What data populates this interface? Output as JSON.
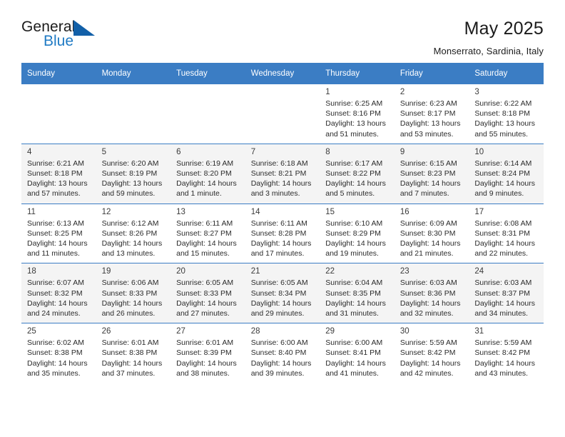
{
  "brand": {
    "name_top": "General",
    "name_bottom": "Blue",
    "triangle_color": "#1260a8",
    "blue_text_color": "#1f7ac4"
  },
  "header": {
    "title": "May 2025",
    "subtitle": "Monserrato, Sardinia, Italy"
  },
  "theme": {
    "header_row_bg": "#3b7dc4",
    "header_row_text": "#ffffff",
    "alt_row_bg": "#f4f4f4",
    "row_divider": "#3b7dc4"
  },
  "weekdays": [
    "Sunday",
    "Monday",
    "Tuesday",
    "Wednesday",
    "Thursday",
    "Friday",
    "Saturday"
  ],
  "labels": {
    "sunrise": "Sunrise:",
    "sunset": "Sunset:",
    "daylight": "Daylight:"
  },
  "weeks": [
    {
      "shaded": false,
      "days": [
        null,
        null,
        null,
        null,
        {
          "num": "1",
          "sunrise": "Sunrise: 6:25 AM",
          "sunset": "Sunset: 8:16 PM",
          "daylight_line1": "Daylight: 13 hours",
          "daylight_line2": "and 51 minutes."
        },
        {
          "num": "2",
          "sunrise": "Sunrise: 6:23 AM",
          "sunset": "Sunset: 8:17 PM",
          "daylight_line1": "Daylight: 13 hours",
          "daylight_line2": "and 53 minutes."
        },
        {
          "num": "3",
          "sunrise": "Sunrise: 6:22 AM",
          "sunset": "Sunset: 8:18 PM",
          "daylight_line1": "Daylight: 13 hours",
          "daylight_line2": "and 55 minutes."
        }
      ]
    },
    {
      "shaded": true,
      "days": [
        {
          "num": "4",
          "sunrise": "Sunrise: 6:21 AM",
          "sunset": "Sunset: 8:18 PM",
          "daylight_line1": "Daylight: 13 hours",
          "daylight_line2": "and 57 minutes."
        },
        {
          "num": "5",
          "sunrise": "Sunrise: 6:20 AM",
          "sunset": "Sunset: 8:19 PM",
          "daylight_line1": "Daylight: 13 hours",
          "daylight_line2": "and 59 minutes."
        },
        {
          "num": "6",
          "sunrise": "Sunrise: 6:19 AM",
          "sunset": "Sunset: 8:20 PM",
          "daylight_line1": "Daylight: 14 hours",
          "daylight_line2": "and 1 minute."
        },
        {
          "num": "7",
          "sunrise": "Sunrise: 6:18 AM",
          "sunset": "Sunset: 8:21 PM",
          "daylight_line1": "Daylight: 14 hours",
          "daylight_line2": "and 3 minutes."
        },
        {
          "num": "8",
          "sunrise": "Sunrise: 6:17 AM",
          "sunset": "Sunset: 8:22 PM",
          "daylight_line1": "Daylight: 14 hours",
          "daylight_line2": "and 5 minutes."
        },
        {
          "num": "9",
          "sunrise": "Sunrise: 6:15 AM",
          "sunset": "Sunset: 8:23 PM",
          "daylight_line1": "Daylight: 14 hours",
          "daylight_line2": "and 7 minutes."
        },
        {
          "num": "10",
          "sunrise": "Sunrise: 6:14 AM",
          "sunset": "Sunset: 8:24 PM",
          "daylight_line1": "Daylight: 14 hours",
          "daylight_line2": "and 9 minutes."
        }
      ]
    },
    {
      "shaded": false,
      "days": [
        {
          "num": "11",
          "sunrise": "Sunrise: 6:13 AM",
          "sunset": "Sunset: 8:25 PM",
          "daylight_line1": "Daylight: 14 hours",
          "daylight_line2": "and 11 minutes."
        },
        {
          "num": "12",
          "sunrise": "Sunrise: 6:12 AM",
          "sunset": "Sunset: 8:26 PM",
          "daylight_line1": "Daylight: 14 hours",
          "daylight_line2": "and 13 minutes."
        },
        {
          "num": "13",
          "sunrise": "Sunrise: 6:11 AM",
          "sunset": "Sunset: 8:27 PM",
          "daylight_line1": "Daylight: 14 hours",
          "daylight_line2": "and 15 minutes."
        },
        {
          "num": "14",
          "sunrise": "Sunrise: 6:11 AM",
          "sunset": "Sunset: 8:28 PM",
          "daylight_line1": "Daylight: 14 hours",
          "daylight_line2": "and 17 minutes."
        },
        {
          "num": "15",
          "sunrise": "Sunrise: 6:10 AM",
          "sunset": "Sunset: 8:29 PM",
          "daylight_line1": "Daylight: 14 hours",
          "daylight_line2": "and 19 minutes."
        },
        {
          "num": "16",
          "sunrise": "Sunrise: 6:09 AM",
          "sunset": "Sunset: 8:30 PM",
          "daylight_line1": "Daylight: 14 hours",
          "daylight_line2": "and 21 minutes."
        },
        {
          "num": "17",
          "sunrise": "Sunrise: 6:08 AM",
          "sunset": "Sunset: 8:31 PM",
          "daylight_line1": "Daylight: 14 hours",
          "daylight_line2": "and 22 minutes."
        }
      ]
    },
    {
      "shaded": true,
      "days": [
        {
          "num": "18",
          "sunrise": "Sunrise: 6:07 AM",
          "sunset": "Sunset: 8:32 PM",
          "daylight_line1": "Daylight: 14 hours",
          "daylight_line2": "and 24 minutes."
        },
        {
          "num": "19",
          "sunrise": "Sunrise: 6:06 AM",
          "sunset": "Sunset: 8:33 PM",
          "daylight_line1": "Daylight: 14 hours",
          "daylight_line2": "and 26 minutes."
        },
        {
          "num": "20",
          "sunrise": "Sunrise: 6:05 AM",
          "sunset": "Sunset: 8:33 PM",
          "daylight_line1": "Daylight: 14 hours",
          "daylight_line2": "and 27 minutes."
        },
        {
          "num": "21",
          "sunrise": "Sunrise: 6:05 AM",
          "sunset": "Sunset: 8:34 PM",
          "daylight_line1": "Daylight: 14 hours",
          "daylight_line2": "and 29 minutes."
        },
        {
          "num": "22",
          "sunrise": "Sunrise: 6:04 AM",
          "sunset": "Sunset: 8:35 PM",
          "daylight_line1": "Daylight: 14 hours",
          "daylight_line2": "and 31 minutes."
        },
        {
          "num": "23",
          "sunrise": "Sunrise: 6:03 AM",
          "sunset": "Sunset: 8:36 PM",
          "daylight_line1": "Daylight: 14 hours",
          "daylight_line2": "and 32 minutes."
        },
        {
          "num": "24",
          "sunrise": "Sunrise: 6:03 AM",
          "sunset": "Sunset: 8:37 PM",
          "daylight_line1": "Daylight: 14 hours",
          "daylight_line2": "and 34 minutes."
        }
      ]
    },
    {
      "shaded": false,
      "days": [
        {
          "num": "25",
          "sunrise": "Sunrise: 6:02 AM",
          "sunset": "Sunset: 8:38 PM",
          "daylight_line1": "Daylight: 14 hours",
          "daylight_line2": "and 35 minutes."
        },
        {
          "num": "26",
          "sunrise": "Sunrise: 6:01 AM",
          "sunset": "Sunset: 8:38 PM",
          "daylight_line1": "Daylight: 14 hours",
          "daylight_line2": "and 37 minutes."
        },
        {
          "num": "27",
          "sunrise": "Sunrise: 6:01 AM",
          "sunset": "Sunset: 8:39 PM",
          "daylight_line1": "Daylight: 14 hours",
          "daylight_line2": "and 38 minutes."
        },
        {
          "num": "28",
          "sunrise": "Sunrise: 6:00 AM",
          "sunset": "Sunset: 8:40 PM",
          "daylight_line1": "Daylight: 14 hours",
          "daylight_line2": "and 39 minutes."
        },
        {
          "num": "29",
          "sunrise": "Sunrise: 6:00 AM",
          "sunset": "Sunset: 8:41 PM",
          "daylight_line1": "Daylight: 14 hours",
          "daylight_line2": "and 41 minutes."
        },
        {
          "num": "30",
          "sunrise": "Sunrise: 5:59 AM",
          "sunset": "Sunset: 8:42 PM",
          "daylight_line1": "Daylight: 14 hours",
          "daylight_line2": "and 42 minutes."
        },
        {
          "num": "31",
          "sunrise": "Sunrise: 5:59 AM",
          "sunset": "Sunset: 8:42 PM",
          "daylight_line1": "Daylight: 14 hours",
          "daylight_line2": "and 43 minutes."
        }
      ]
    }
  ]
}
